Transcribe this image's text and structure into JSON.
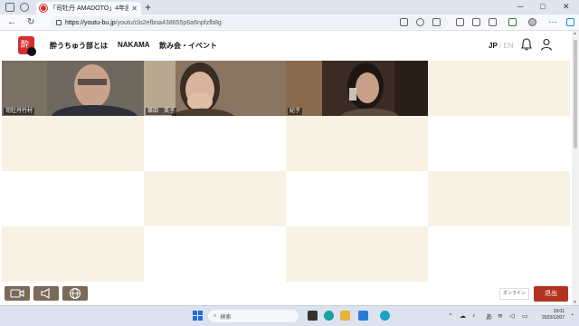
{
  "browser": {
    "tab_title": "「司牡丹 AMADOTO」4年連続",
    "url_host": "https://youtu-bu.jp",
    "url_path": "/youtu/clo2efbna438655p6a6npfzfb8g"
  },
  "site": {
    "logo_text": "酔",
    "nav": [
      "酔うちゅう部とは",
      "NAKAMA",
      "飲み会・イベント"
    ],
    "lang_jp": "JP",
    "lang_sep": " / ",
    "lang_en": "EN"
  },
  "participants": [
    {
      "name": "司牡丹竹村"
    },
    {
      "name": "篠田　英子"
    },
    {
      "name": "紀子"
    }
  ],
  "controls": {
    "status_label": "オンライン",
    "leave_label": "退出"
  },
  "taskbar": {
    "search_placeholder": "検索",
    "ime": "あ",
    "time": "19:01",
    "date": "2023/12/07"
  },
  "colors": {
    "beige_cell": "#f7f2e4",
    "leave_button": "#b2321f",
    "control_button": "#7b6a58"
  }
}
